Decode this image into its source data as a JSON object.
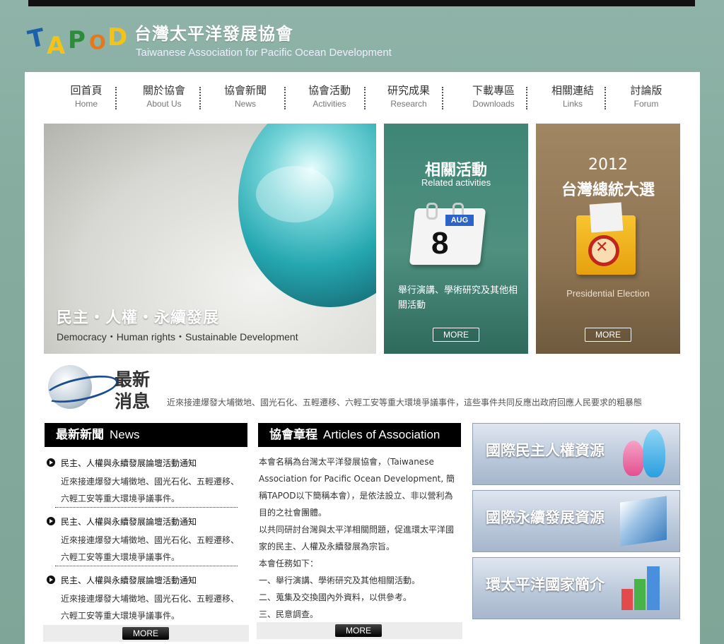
{
  "site": {
    "title_zh": "台灣太平洋發展協會",
    "title_en": "Taiwanese Association for Pacific Ocean Development",
    "logo_letters": [
      "T",
      "A",
      "P",
      "O",
      "D"
    ]
  },
  "nav": [
    {
      "zh": "回首頁",
      "en": "Home"
    },
    {
      "zh": "關於協會",
      "en": "About Us"
    },
    {
      "zh": "協會新聞",
      "en": "News"
    },
    {
      "zh": "協會活動",
      "en": "Activities"
    },
    {
      "zh": "研究成果",
      "en": "Research"
    },
    {
      "zh": "下載專區",
      "en": "Downloads"
    },
    {
      "zh": "相關連結",
      "en": "Links"
    },
    {
      "zh": "討論版",
      "en": "Forum"
    }
  ],
  "hero": {
    "title": "民主・人權・永續發展",
    "subtitle": "Democracy・Human rights・Sustainable Development"
  },
  "cards": {
    "activities": {
      "title": "相關活動",
      "subtitle": "Related activities",
      "calendar_month": "AUG",
      "calendar_day": "8",
      "description": "舉行演講、學術研究及其他相關活動",
      "more": "MORE"
    },
    "election": {
      "year": "2012",
      "title": "台灣總統大選",
      "subtitle": "Presidential Election",
      "more": "MORE"
    }
  },
  "latest": {
    "label_line1": "最新",
    "label_line2": "消息",
    "ticker": "近來接連爆發大埔徵地、國光石化、五輕遷移、六輕工安等重大環境爭議事件，這些事件共同反應出政府回應人民要求的粗暴態"
  },
  "news": {
    "heading_zh": "最新新聞",
    "heading_en": "News",
    "items": [
      {
        "title": "民主、人權與永續發展論壇活動通知",
        "body": "近來接連爆發大埔徵地、國光石化、五輕遷移、六輕工安等重大環境爭議事件。"
      },
      {
        "title": "民主、人權與永續發展論壇活動通知",
        "body": "近來接連爆發大埔徵地、國光石化、五輕遷移、六輕工安等重大環境爭議事件。"
      },
      {
        "title": "民主、人權與永續發展論壇活動通知",
        "body": "近來接連爆發大埔徵地、國光石化、五輕遷移、六輕工安等重大環境爭議事件。"
      }
    ],
    "more": "MORE"
  },
  "articles": {
    "heading_zh": "協會章程",
    "heading_en": "Articles of Association",
    "paragraphs": [
      "本會名稱為台灣太平洋發展協會，（Taiwanese Association for Pacific Ocean Development, 簡稱TAPOD以下簡稱本會），是依法設立、非以營利為目的之社會團體。",
      "以共同研討台灣與太平洋相關問題，促進環太平洋國家的民主、人權及永續發展為宗旨。",
      "本會任務如下：",
      "一、舉行演講、學術研究及其他相關活動。",
      "二、蒐集及交換國內外資料，以供參考。",
      "三、民意調查。"
    ],
    "more": "MORE"
  },
  "resources": [
    {
      "label": "國際民主人權資源"
    },
    {
      "label": "國際永續發展資源"
    },
    {
      "label": "環太平洋國家簡介"
    }
  ]
}
